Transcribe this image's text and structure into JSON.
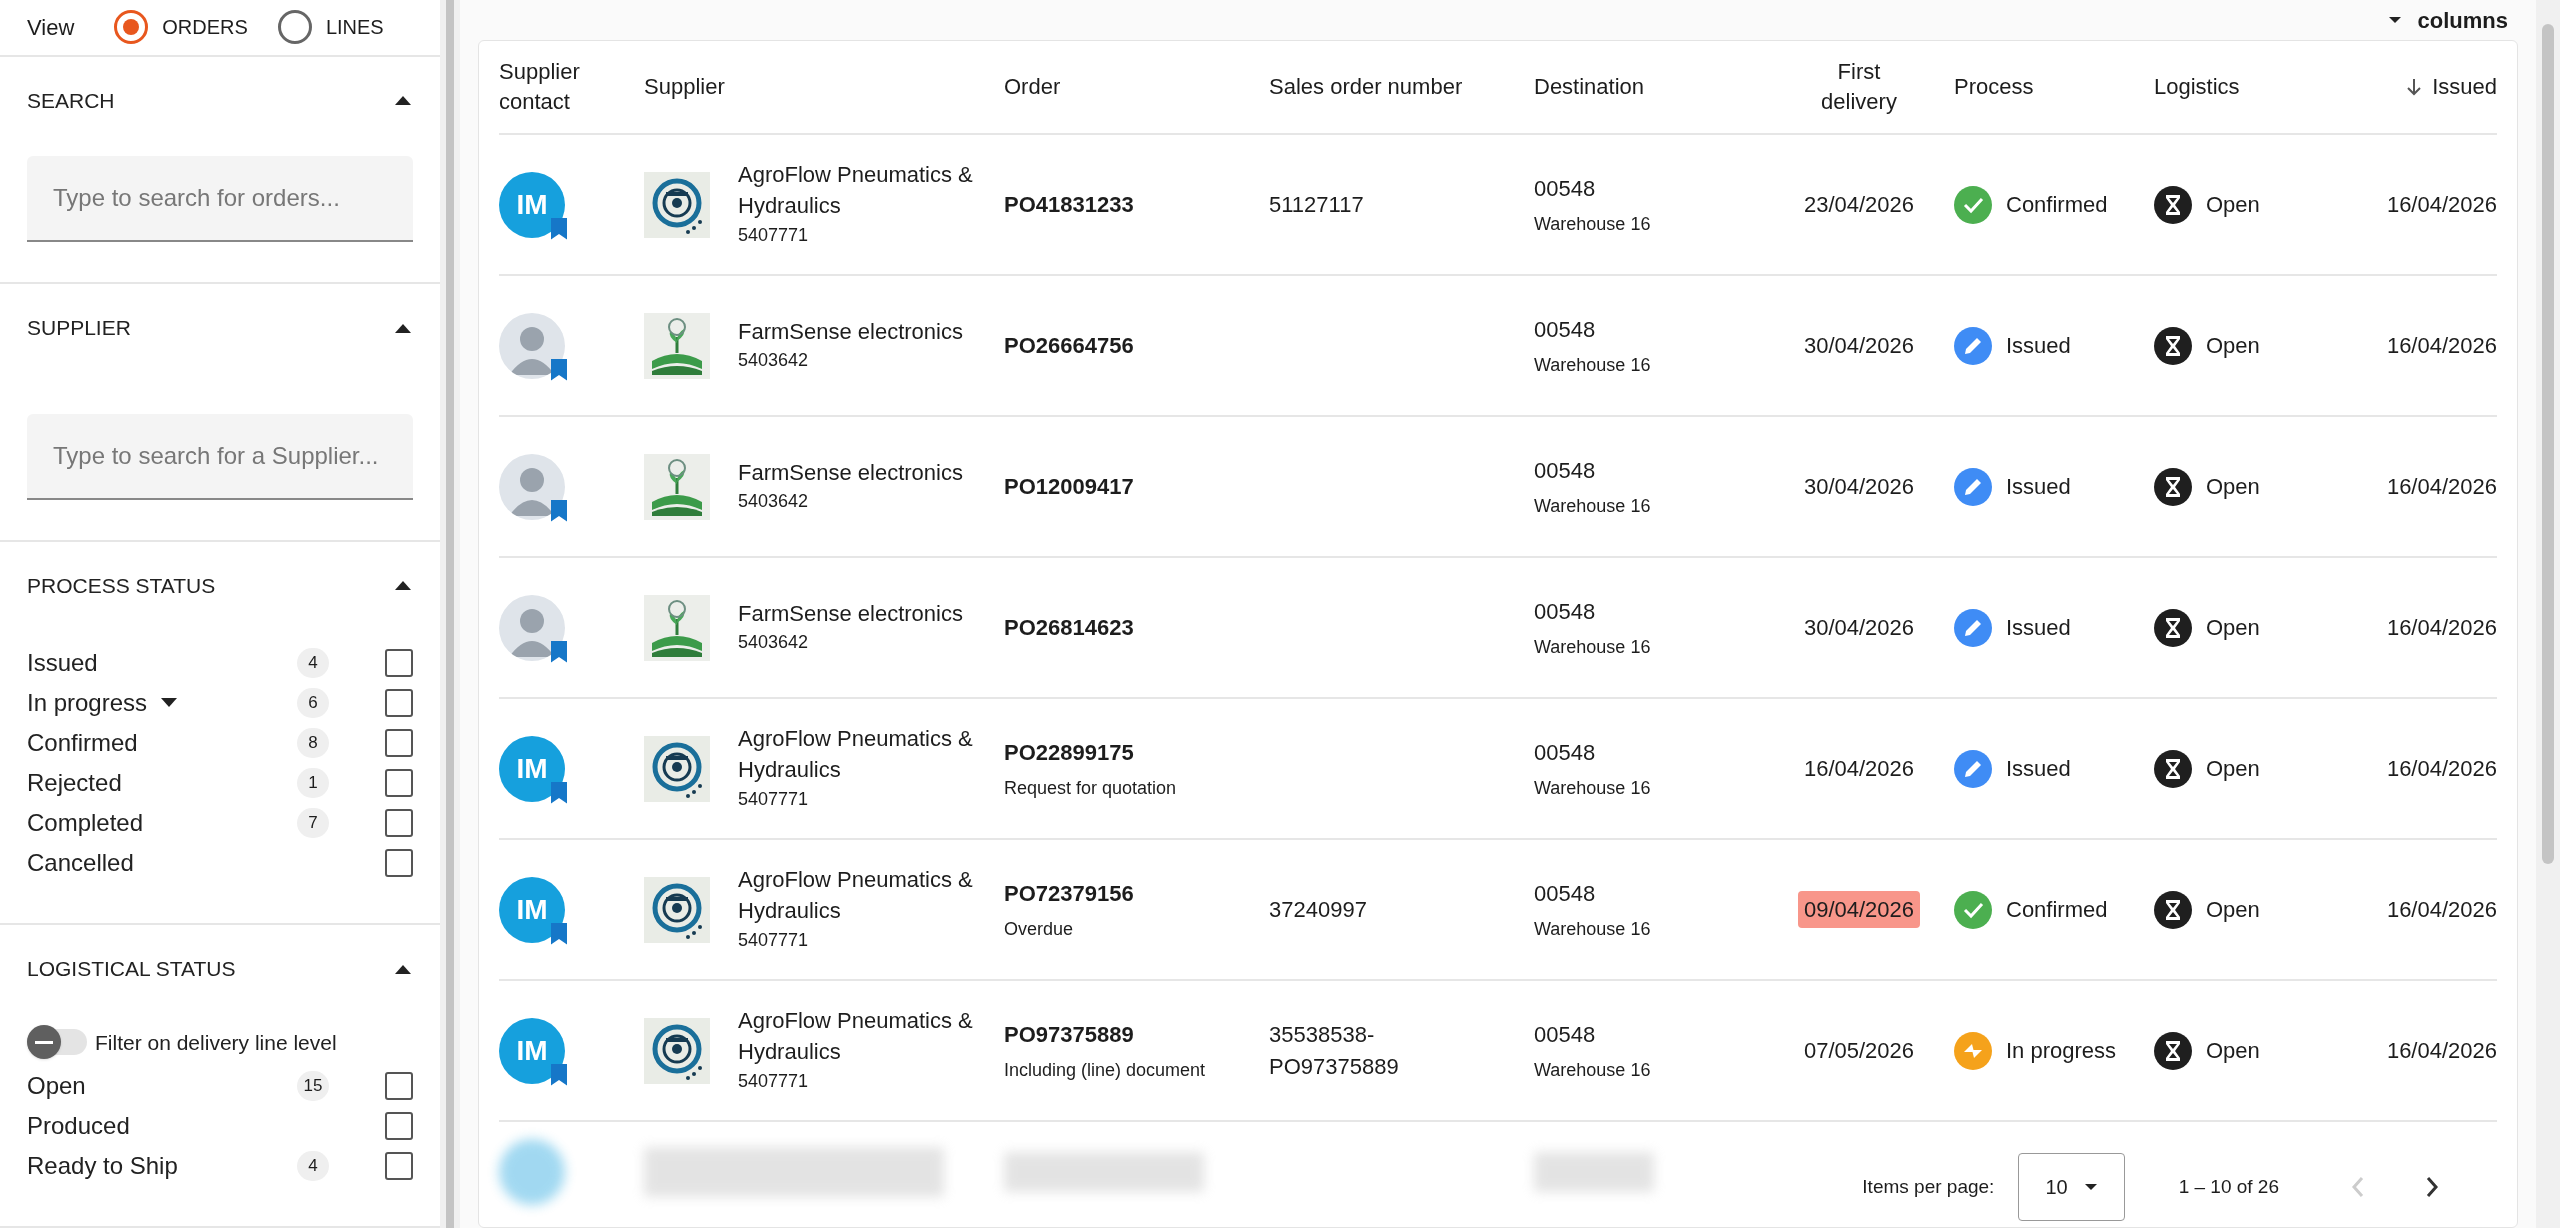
{
  "view": {
    "label": "View",
    "options": [
      {
        "label": "ORDERS",
        "selected": true
      },
      {
        "label": "LINES",
        "selected": false
      }
    ]
  },
  "filters": [
    {
      "kind": "search",
      "title": "SEARCH",
      "expanded": true,
      "placeholder": "Type to search for orders..."
    },
    {
      "kind": "search",
      "title": "SUPPLIER",
      "expanded": true,
      "placeholder": "Type to search for a Supplier..."
    },
    {
      "kind": "checklist",
      "title": "PROCESS STATUS",
      "expanded": true,
      "items": [
        {
          "label": "Issued",
          "count": "4",
          "checked": false
        },
        {
          "label": "In progress",
          "count": "6",
          "checked": false,
          "has_menu": true
        },
        {
          "label": "Confirmed",
          "count": "8",
          "checked": false
        },
        {
          "label": "Rejected",
          "count": "1",
          "checked": false
        },
        {
          "label": "Completed",
          "count": "7",
          "checked": false
        },
        {
          "label": "Cancelled",
          "checked": false
        }
      ]
    },
    {
      "kind": "checklist",
      "title": "LOGISTICAL STATUS",
      "expanded": true,
      "toggle": {
        "label": "Filter on delivery line level",
        "on": false
      },
      "items": [
        {
          "label": "Open",
          "count": "15",
          "checked": false
        },
        {
          "label": "Produced",
          "checked": false
        },
        {
          "label": "Ready to Ship",
          "count": "4",
          "checked": false
        }
      ]
    }
  ],
  "columns_button": "columns",
  "table": {
    "columns": [
      {
        "label": "Supplier contact",
        "kind": "left"
      },
      {
        "label": "Supplier",
        "kind": "left"
      },
      {
        "label": "Order",
        "kind": "left"
      },
      {
        "label": "Sales order number",
        "kind": "left"
      },
      {
        "label": "Destination",
        "kind": "left"
      },
      {
        "label": "First delivery",
        "kind": "center"
      },
      {
        "label": "Process",
        "kind": "left"
      },
      {
        "label": "Logistics",
        "kind": "left"
      },
      {
        "label": "Issued",
        "kind": "right",
        "sorted": true
      }
    ],
    "rows": [
      {
        "contact": {
          "kind": "initials",
          "initials": "IM"
        },
        "supplier": {
          "kind": "gauge",
          "name": "AgroFlow Pneumatics & Hydraulics",
          "number": "5407771"
        },
        "order": "PO41831233",
        "sales_order": "51127117",
        "destination": "00548",
        "warehouse": "Warehouse 16",
        "first_delivery": "23/04/2026",
        "overdue": false,
        "process": {
          "kind": "confirmed",
          "label": "Confirmed"
        },
        "logistics": "Open",
        "issued": "16/04/2026"
      },
      {
        "contact": {
          "kind": "photo"
        },
        "supplier": {
          "kind": "field",
          "name": "FarmSense electronics",
          "number": "5403642"
        },
        "order": "PO26664756",
        "destination": "00548",
        "warehouse": "Warehouse 16",
        "first_delivery": "30/04/2026",
        "overdue": false,
        "process": {
          "kind": "issued",
          "label": "Issued"
        },
        "logistics": "Open",
        "issued": "16/04/2026"
      },
      {
        "contact": {
          "kind": "photo"
        },
        "supplier": {
          "kind": "field",
          "name": "FarmSense electronics",
          "number": "5403642"
        },
        "order": "PO12009417",
        "destination": "00548",
        "warehouse": "Warehouse 16",
        "first_delivery": "30/04/2026",
        "overdue": false,
        "process": {
          "kind": "issued",
          "label": "Issued"
        },
        "logistics": "Open",
        "issued": "16/04/2026"
      },
      {
        "contact": {
          "kind": "photo"
        },
        "supplier": {
          "kind": "field",
          "name": "FarmSense electronics",
          "number": "5403642"
        },
        "order": "PO26814623",
        "destination": "00548",
        "warehouse": "Warehouse 16",
        "first_delivery": "30/04/2026",
        "overdue": false,
        "process": {
          "kind": "issued",
          "label": "Issued"
        },
        "logistics": "Open",
        "issued": "16/04/2026"
      },
      {
        "contact": {
          "kind": "initials",
          "initials": "IM"
        },
        "supplier": {
          "kind": "gauge",
          "name": "AgroFlow Pneumatics & Hydraulics",
          "number": "5407771"
        },
        "order": "PO22899175",
        "order_note": "Request for quotation",
        "destination": "00548",
        "warehouse": "Warehouse 16",
        "first_delivery": "16/04/2026",
        "overdue": false,
        "process": {
          "kind": "issued",
          "label": "Issued"
        },
        "logistics": "Open",
        "issued": "16/04/2026"
      },
      {
        "contact": {
          "kind": "initials",
          "initials": "IM"
        },
        "supplier": {
          "kind": "gauge",
          "name": "AgroFlow Pneumatics & Hydraulics",
          "number": "5407771"
        },
        "order": "PO72379156",
        "order_note": "Overdue",
        "sales_order": "37240997",
        "destination": "00548",
        "warehouse": "Warehouse 16",
        "first_delivery": "09/04/2026",
        "overdue": true,
        "process": {
          "kind": "confirmed",
          "label": "Confirmed"
        },
        "logistics": "Open",
        "issued": "16/04/2026"
      },
      {
        "contact": {
          "kind": "initials",
          "initials": "IM"
        },
        "supplier": {
          "kind": "gauge",
          "name": "AgroFlow Pneumatics & Hydraulics",
          "number": "5407771"
        },
        "order": "PO97375889",
        "order_note": "Including (line) document",
        "sales_order": "35538538-PO97375889",
        "destination": "00548",
        "warehouse": "Warehouse 16",
        "first_delivery": "07/05/2026",
        "overdue": false,
        "process": {
          "kind": "in_progress",
          "label": "In progress"
        },
        "logistics": "Open",
        "issued": "16/04/2026"
      }
    ]
  },
  "pagination": {
    "items_per_page_label": "Items per page:",
    "items_per_page": "10",
    "range": "1 – 10 of 26",
    "prev_disabled": true,
    "next_disabled": false
  }
}
